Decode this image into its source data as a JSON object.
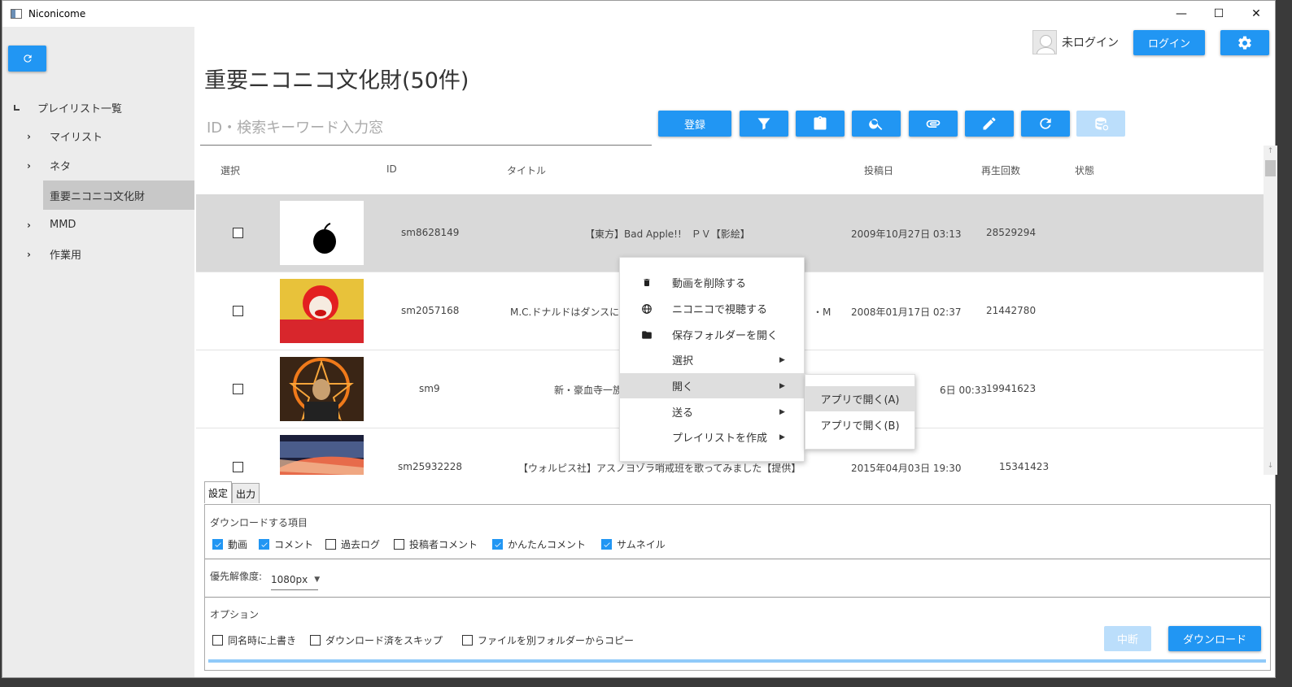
{
  "window": {
    "title": "Niconicome",
    "minimize": "—",
    "maximize": "☐",
    "close": "✕"
  },
  "header": {
    "playlist_title": "重要ニコニコ文化財(50件)",
    "user_label": "未ログイン",
    "login_label": "ログイン"
  },
  "sidebar": {
    "root_label": "プレイリスト一覧",
    "items": [
      {
        "label": "マイリスト",
        "expandable": true
      },
      {
        "label": "ネタ",
        "expandable": true
      },
      {
        "label": "重要ニコニコ文化財",
        "expandable": false,
        "selected": true
      },
      {
        "label": "MMD",
        "expandable": true
      },
      {
        "label": "作業用",
        "expandable": true
      }
    ]
  },
  "search": {
    "placeholder": "ID・検索キーワード入力窓",
    "value": ""
  },
  "toolbar": {
    "register_label": "登録",
    "buttons": [
      "filter-icon",
      "clipboard-icon",
      "search-icon",
      "paperclip-icon",
      "pencil-icon",
      "refresh-icon",
      "database-sync-icon"
    ]
  },
  "table": {
    "headers": {
      "select": "選択",
      "id": "ID",
      "title": "タイトル",
      "posted": "投稿日",
      "views": "再生回数",
      "status": "状態"
    },
    "rows": [
      {
        "id": "sm8628149",
        "title": "【東方】Bad Apple!!　ＰＶ【影絵】",
        "posted": "2009年10月27日 03:13",
        "views": "28529294",
        "selected": true
      },
      {
        "id": "sm2057168",
        "title": "M.C.ドナルドはダンスに",
        "title_tail": "・M",
        "posted": "2008年01月17日 02:37",
        "views": "21442780"
      },
      {
        "id": "sm9",
        "title": "新・豪血寺一族",
        "posted_tail": "6日 00:33",
        "views": "19941623"
      },
      {
        "id": "sm25932228",
        "title": "【ウォルピス社】アスノヨゾラ哨戒班を歌ってみました【提供】",
        "posted": "2015年04月03日 19:30",
        "views": "15341423"
      }
    ]
  },
  "context_menu": {
    "items": [
      {
        "label": "動画を削除する",
        "icon": "trash-icon"
      },
      {
        "label": "ニコニコで視聴する",
        "icon": "globe-icon"
      },
      {
        "label": "保存フォルダーを開く",
        "icon": "folder-icon"
      },
      {
        "label": "選択",
        "submenu": true
      },
      {
        "label": "開く",
        "submenu": true,
        "highlighted": true
      },
      {
        "label": "送る",
        "submenu": true
      },
      {
        "label": "プレイリストを作成",
        "submenu": true
      }
    ],
    "submenu": [
      {
        "label": "アプリで開く(A)",
        "highlighted": true
      },
      {
        "label": "アプリで開く(B)"
      }
    ]
  },
  "bottom": {
    "tabs": [
      "設定",
      "出力"
    ],
    "download_items_label": "ダウンロードする項目",
    "download_items": [
      {
        "label": "動画",
        "checked": true
      },
      {
        "label": "コメント",
        "checked": true
      },
      {
        "label": "過去ログ",
        "checked": false
      },
      {
        "label": "投稿者コメント",
        "checked": false
      },
      {
        "label": "かんたんコメント",
        "checked": true
      },
      {
        "label": "サムネイル",
        "checked": true
      }
    ],
    "resolution_label": "優先解像度:",
    "resolution_value": "1080px",
    "options_label": "オプション",
    "options": [
      {
        "label": "同名時に上書き",
        "checked": false
      },
      {
        "label": "ダウンロード済をスキップ",
        "checked": false
      },
      {
        "label": "ファイルを別フォルダーからコピー",
        "checked": false
      }
    ],
    "stop_label": "中断",
    "download_label": "ダウンロード"
  },
  "colors": {
    "accent": "#2196f3",
    "accent_disabled": "#bbdefb",
    "sidebar_bg": "#ececec",
    "row_selected": "#d9d9d9"
  }
}
